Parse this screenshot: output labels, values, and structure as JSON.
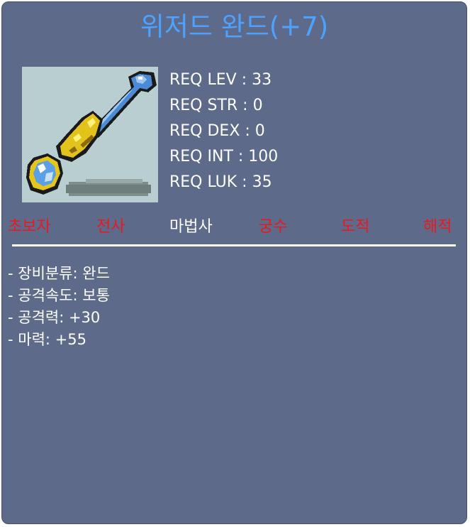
{
  "item": {
    "name": "위저드 완드(+7)",
    "image_icon": "wizard-wand-icon"
  },
  "requirements": [
    {
      "text": "REQ LEV : 33"
    },
    {
      "text": "REQ STR : 0"
    },
    {
      "text": "REQ DEX : 0"
    },
    {
      "text": "REQ INT : 100"
    },
    {
      "text": "REQ LUK : 35"
    }
  ],
  "jobs": [
    {
      "label": "초보자",
      "allowed": false
    },
    {
      "label": "전사",
      "allowed": false
    },
    {
      "label": "마법사",
      "allowed": true
    },
    {
      "label": "궁수",
      "allowed": false
    },
    {
      "label": "도적",
      "allowed": false
    },
    {
      "label": "해적",
      "allowed": false
    }
  ],
  "stats": [
    {
      "text": "- 장비분류: 완드"
    },
    {
      "text": "- 공격속도: 보통"
    },
    {
      "text": "- 공격력: +30"
    },
    {
      "text": "- 마력: +55"
    }
  ],
  "colors": {
    "panel_bg": "#5d6a89",
    "title": "#4da2ff",
    "restricted_job": "#e8191f",
    "allowed_job": "#ffffff",
    "image_bg": "#b9ced0"
  }
}
